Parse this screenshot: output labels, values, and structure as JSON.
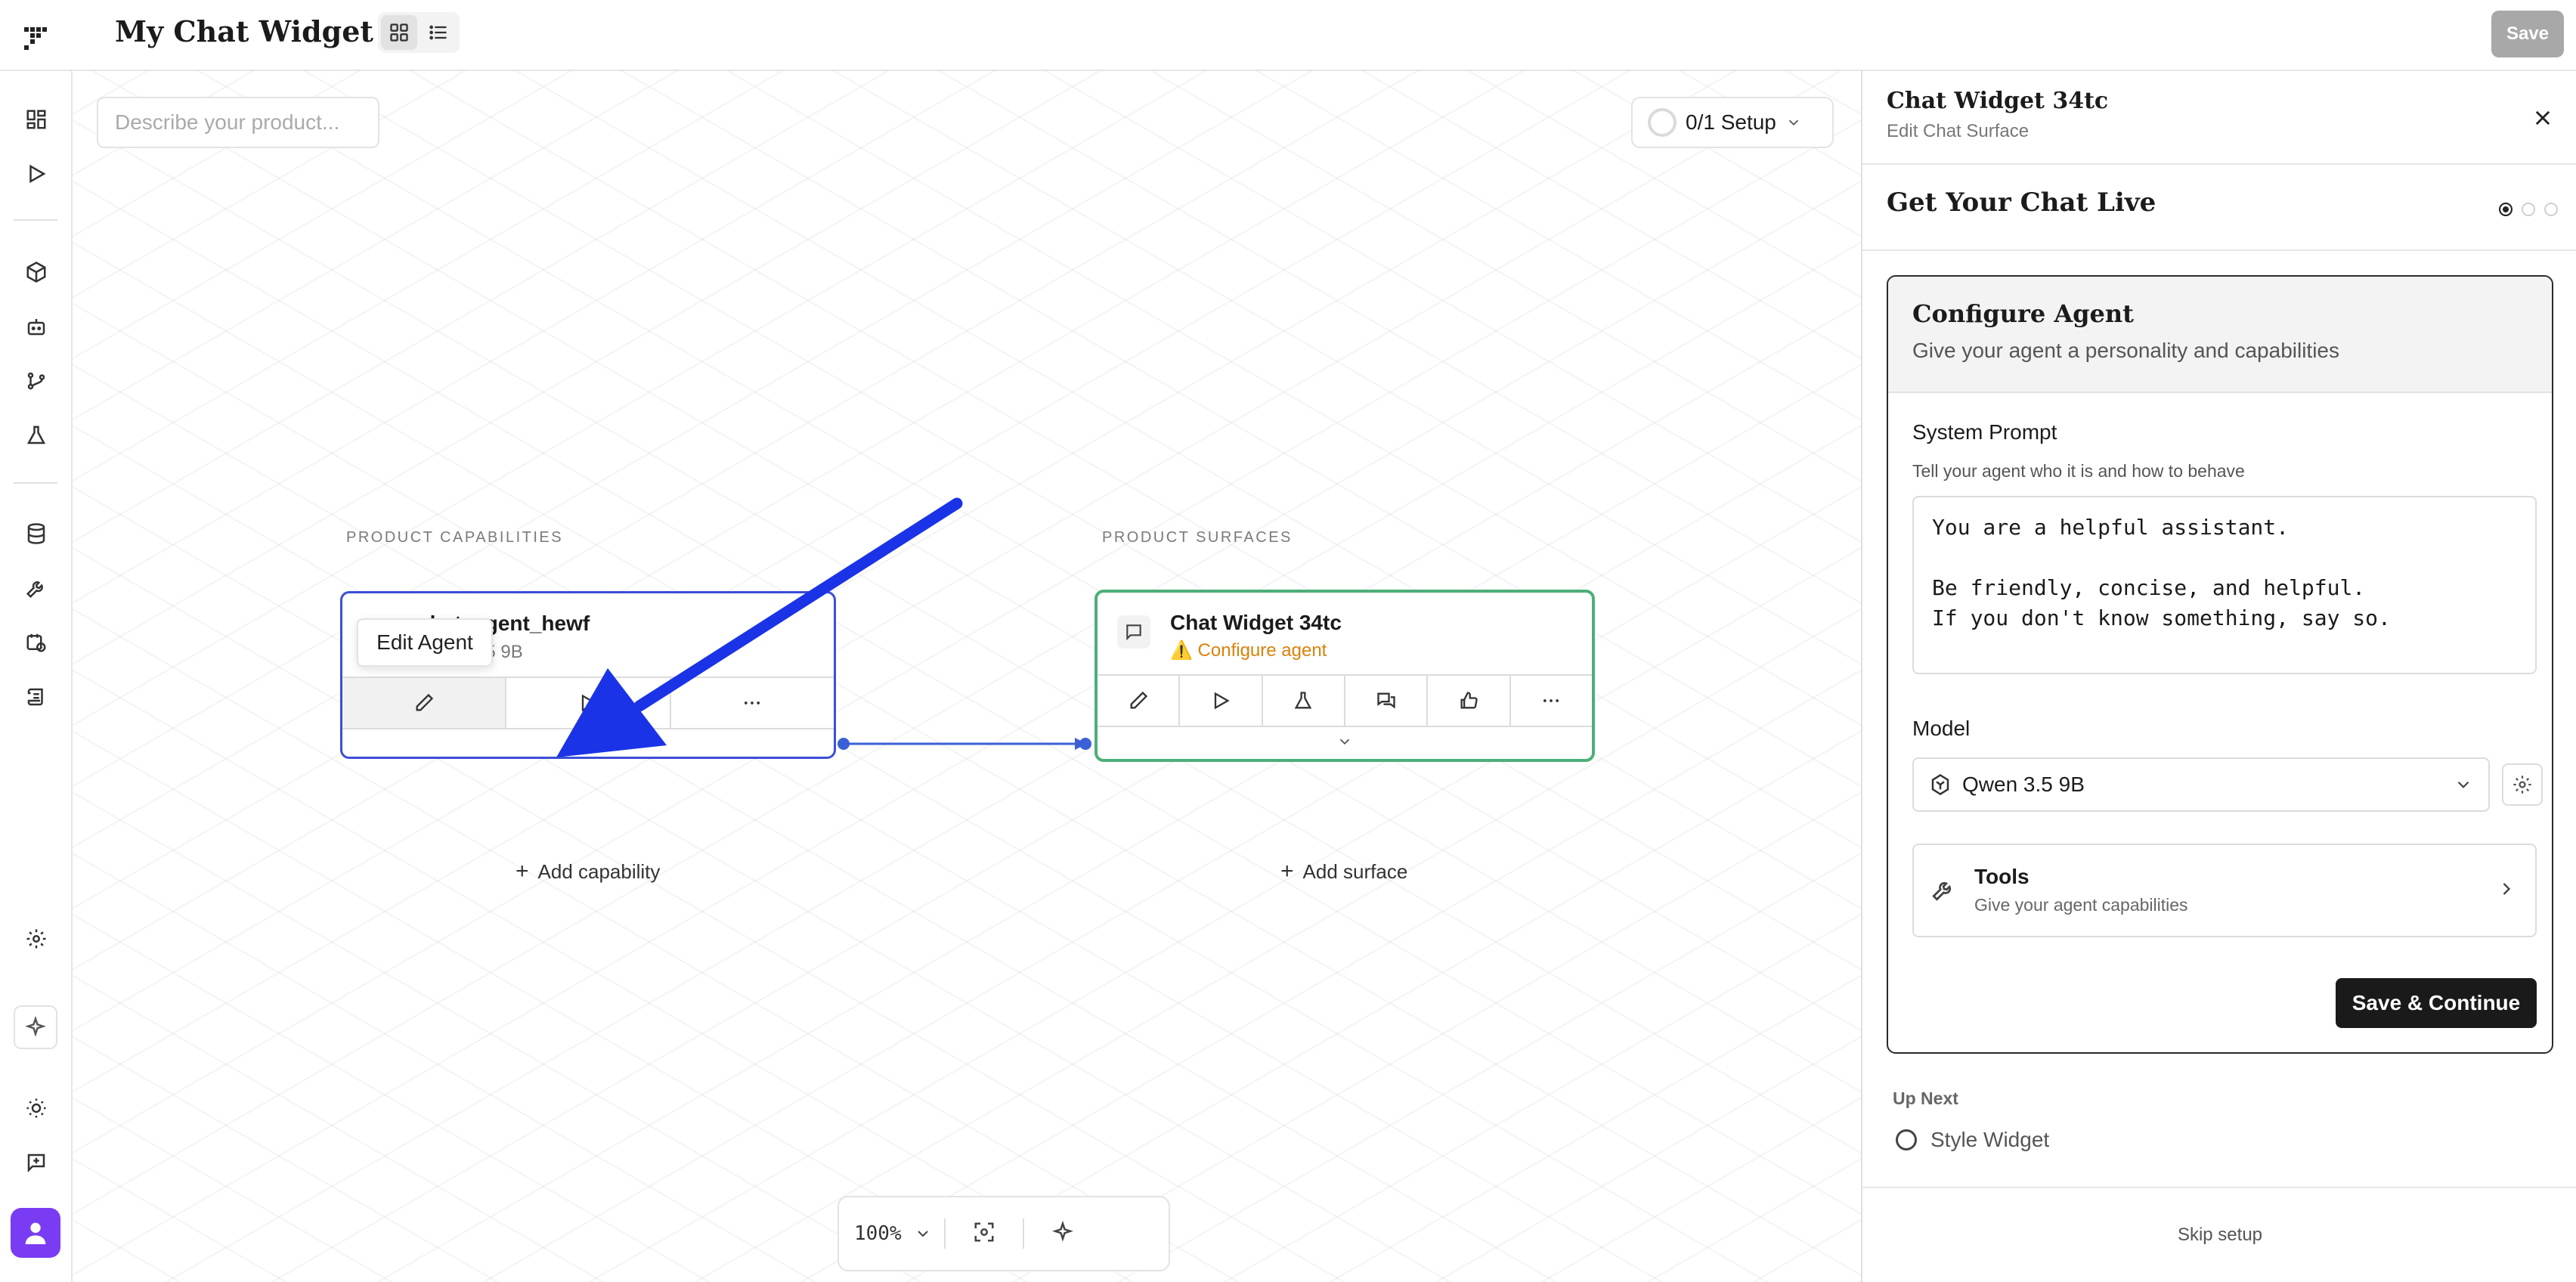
{
  "header": {
    "title": "My Chat Widget",
    "save_label": "Save"
  },
  "canvas": {
    "describe_placeholder": "Describe your product...",
    "setup_progress": "0/1 Setup",
    "capabilities_label": "PRODUCT CAPABILITIES",
    "surfaces_label": "PRODUCT SURFACES",
    "agent_node": {
      "name": "chat_agent_hewf",
      "model": "Qwen 3.5 9B"
    },
    "surface_node": {
      "name": "Chat Widget 34tc",
      "warning": "⚠️ Configure agent"
    },
    "tooltip": "Edit Agent",
    "add_capability": "Add capability",
    "add_surface": "Add surface",
    "zoom": "100%"
  },
  "panel": {
    "title": "Chat Widget 34tc",
    "subtitle": "Edit Chat Surface",
    "step_title": "Get Your Chat Live",
    "card": {
      "title": "Configure Agent",
      "subtitle": "Give your agent a personality and capabilities",
      "system_prompt_label": "System Prompt",
      "system_prompt_help": "Tell your agent who it is and how to behave",
      "system_prompt_value": "You are a helpful assistant.\n\nBe friendly, concise, and helpful.\nIf you don't know something, say so.",
      "model_label": "Model",
      "model_value": "Qwen 3.5 9B",
      "tools_title": "Tools",
      "tools_sub": "Give your agent capabilities",
      "save_continue": "Save & Continue"
    },
    "up_next_label": "Up Next",
    "up_next_item": "Style Widget",
    "skip": "Skip setup"
  },
  "colors": {
    "agent_border": "#3b4fd6",
    "surface_border": "#4caf78",
    "arrow": "#1a33e6",
    "warning": "#d9820a",
    "avatar": "#7a3cf2"
  }
}
